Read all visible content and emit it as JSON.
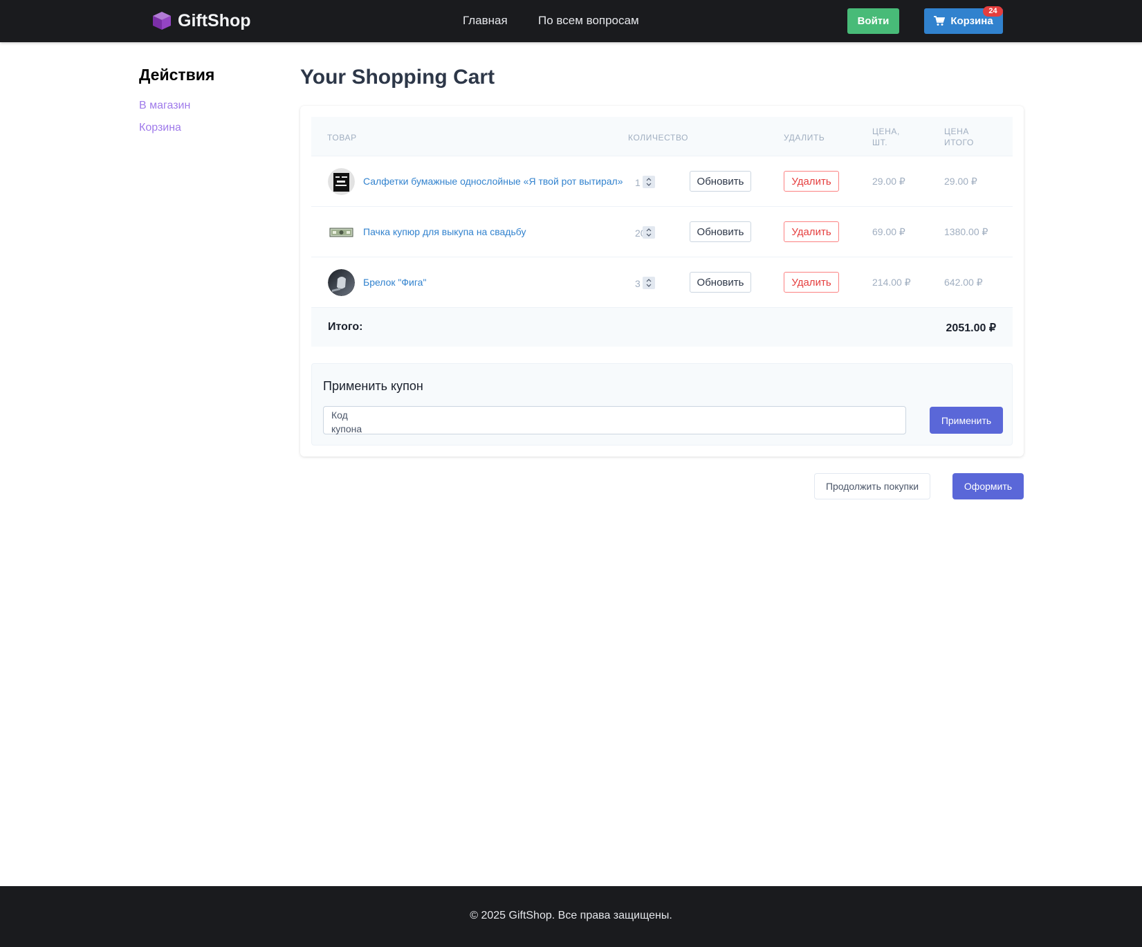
{
  "header": {
    "brand": "GiftShop",
    "nav": [
      "Главная",
      "По всем вопросам"
    ],
    "login_label": "Войти",
    "cart_label": "Корзина",
    "cart_count": "24"
  },
  "sidebar": {
    "title": "Действия",
    "links": [
      "В магазин",
      "Корзина"
    ]
  },
  "main": {
    "title": "Your Shopping Cart",
    "columns": {
      "product": "ТОВАР",
      "quantity": "КОЛИЧЕСТВО",
      "delete": "УДАЛИТЬ",
      "unit_price": "ЦЕНА, ШТ.",
      "total_price": "ЦЕНА ИТОГО"
    },
    "items": [
      {
        "name": "Салфетки бумажные однослойные «Я твой рот вытирал»",
        "qty": "1",
        "unit": "29.00 ₽",
        "total": "29.00 ₽",
        "update": "Обновить",
        "delete": "Удалить"
      },
      {
        "name": "Пачка купюр для выкупа на свадьбу",
        "qty": "20",
        "unit": "69.00 ₽",
        "total": "1380.00 ₽",
        "update": "Обновить",
        "delete": "Удалить"
      },
      {
        "name": "Брелок \"Фига\"",
        "qty": "3",
        "unit": "214.00 ₽",
        "total": "642.00 ₽",
        "update": "Обновить",
        "delete": "Удалить"
      }
    ],
    "total_label": "Итого:",
    "total_value": "2051.00 ₽",
    "coupon": {
      "title": "Применить купон",
      "placeholder": "Код купона",
      "apply": "Применить"
    },
    "continue_label": "Продолжить покупки",
    "checkout_label": "Оформить"
  },
  "footer": {
    "text": "© 2025 GiftShop. Все права защищены."
  },
  "colors": {
    "header_bg": "#1a1b1e",
    "login_green": "#48bb78",
    "cart_blue": "#3182ce",
    "badge_red": "#e53e3e",
    "accent_indigo": "#5a67d8",
    "sidebar_link": "#9f7aea"
  }
}
